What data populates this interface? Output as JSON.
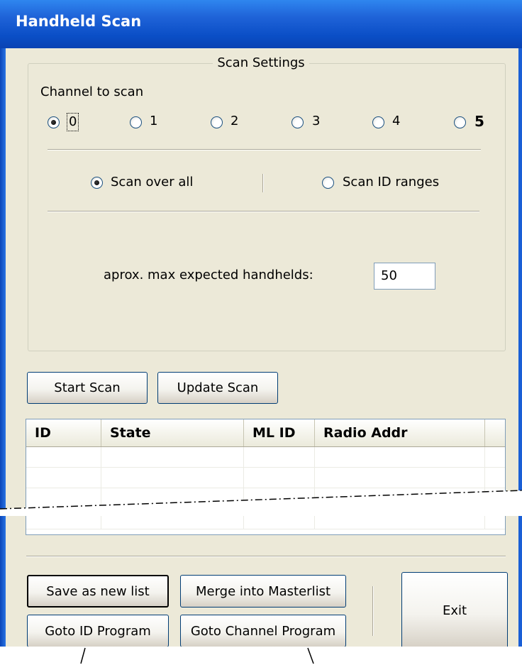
{
  "window": {
    "title": "Handheld Scan"
  },
  "scan_settings": {
    "legend": "Scan Settings",
    "channel_label": "Channel to scan",
    "channels": [
      {
        "label": "0",
        "selected": true
      },
      {
        "label": "1",
        "selected": false
      },
      {
        "label": "2",
        "selected": false
      },
      {
        "label": "3",
        "selected": false
      },
      {
        "label": "4",
        "selected": false
      },
      {
        "label": "5",
        "selected": false
      }
    ],
    "mode_all": "Scan over all",
    "mode_ranges": "Scan ID ranges",
    "mode_selected": "all",
    "max_label": "aprox. max expected handhelds:",
    "max_value": "50"
  },
  "actions": {
    "start": "Start Scan",
    "update": "Update Scan"
  },
  "table": {
    "columns": [
      "ID",
      "State",
      "ML ID",
      "Radio Addr",
      ""
    ],
    "rows": [
      [
        "",
        "",
        "",
        "",
        ""
      ],
      [
        "",
        "",
        "",
        "",
        ""
      ],
      [
        "",
        "",
        "",
        "",
        ""
      ],
      [
        "",
        "",
        "",
        "",
        ""
      ]
    ]
  },
  "footer": {
    "save": "Save as new list",
    "merge": "Merge into Masterlist",
    "goto_id": "Goto ID Program",
    "goto_channel": "Goto Channel Program",
    "exit": "Exit"
  }
}
